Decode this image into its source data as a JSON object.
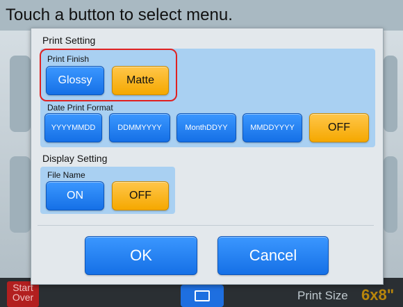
{
  "header": {
    "title": "Touch a button to select menu."
  },
  "bottom_bar": {
    "start_over_label": "Start Over",
    "start_over_line1": "Start",
    "start_over_line2": "Over",
    "center_icon": "print-queue-icon",
    "print_size_label": "Print Size",
    "print_size_value": "6x8\""
  },
  "dialog": {
    "print_setting": {
      "title": "Print Setting",
      "print_finish": {
        "label": "Print Finish",
        "options": [
          "Glossy",
          "Matte"
        ],
        "selected": "Matte"
      },
      "date_print_format": {
        "label": "Date Print Format",
        "options": [
          "YYYYMMDD",
          "DDMMYYYY",
          "MonthDDYY",
          "MMDDYYYY",
          "OFF"
        ],
        "selected": "OFF"
      }
    },
    "display_setting": {
      "title": "Display Setting",
      "file_name": {
        "label": "File Name",
        "options": [
          "ON",
          "OFF"
        ],
        "selected": "OFF"
      }
    },
    "ok_label": "OK",
    "cancel_label": "Cancel"
  },
  "colors": {
    "selected": "#f5a800",
    "unselected": "#1570e6",
    "panel": "#a9d0f2",
    "highlight": "#e02020"
  }
}
